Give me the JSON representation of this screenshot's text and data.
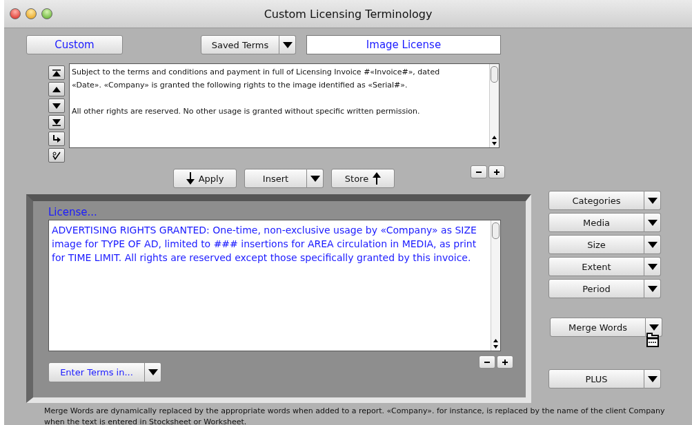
{
  "window": {
    "title": "Custom Licensing Terminology"
  },
  "custom_button": {
    "label": "Custom"
  },
  "saved_terms": {
    "label": "Saved Terms"
  },
  "term_name_field": {
    "value": "Image License"
  },
  "terms_text": {
    "paragraphs": [
      "Subject to the terms and conditions and payment in full of Licensing Invoice #«Invoice#», dated «Date».  «Company» is granted the following rights to the image identified as «Serial#».",
      "All other rights are reserved. No other usage is granted without specific written permission."
    ]
  },
  "action_buttons": [
    {
      "label": "Apply",
      "kind": "lead"
    },
    {
      "label": "Insert",
      "kind": "split"
    },
    {
      "label": "Store",
      "kind": "trail"
    }
  ],
  "license": {
    "label": "License...",
    "text": "ADVERTISING RIGHTS GRANTED:  One-time, non-exclusive usage by «Company» as SIZE image for TYPE OF AD, limited to ### insertions for AREA circulation in MEDIA, as print for TIME LIMIT. All rights are reserved except those specifically granted by this invoice.",
    "enter_terms": "Enter Terms in..."
  },
  "category_menus": [
    {
      "label": "Categories"
    },
    {
      "label": "Media"
    },
    {
      "label": "Size"
    },
    {
      "label": "Extent"
    },
    {
      "label": "Period"
    }
  ],
  "merge_words": {
    "label": "Merge Words"
  },
  "plus_menu": {
    "label": "PLUS"
  },
  "footnote": "Merge Words are dynamically replaced by the appropriate words when added to a report. «Company». for instance, is replaced by the name of the client Company when the text is entered in Stocksheet or Worksheet."
}
